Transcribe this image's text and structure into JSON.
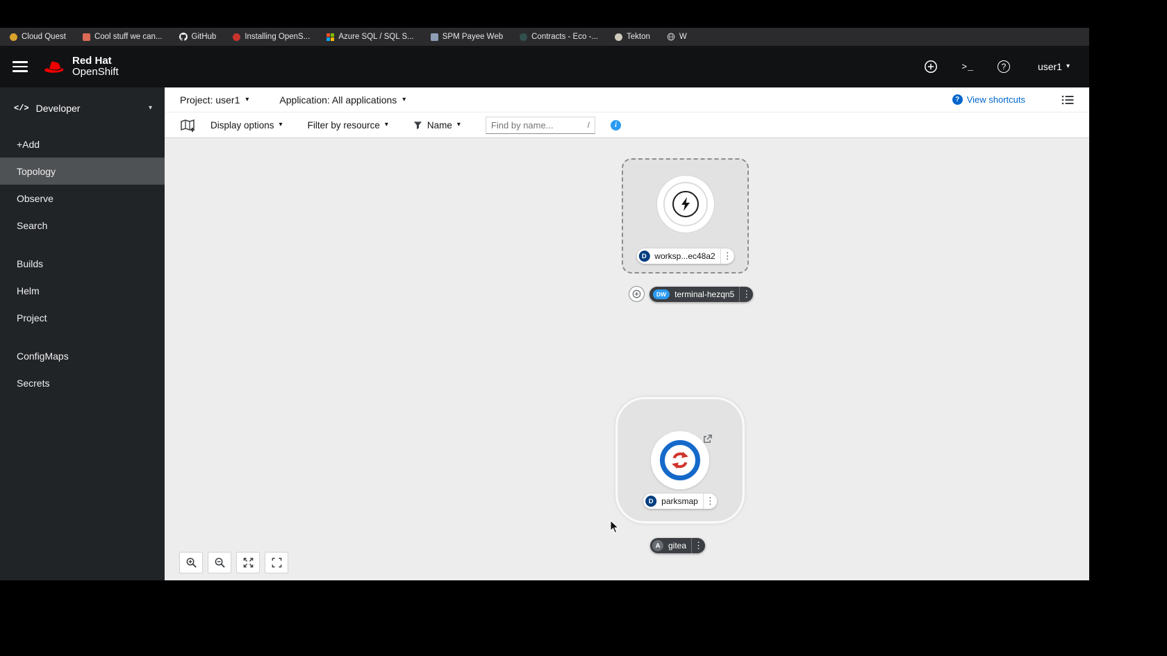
{
  "bookmarks": {
    "items": [
      {
        "label": "Cloud Quest",
        "icon": "cloud-quest-favicon",
        "color": "#d8a22b"
      },
      {
        "label": "Cool stuff we can...",
        "icon": "page-favicon",
        "color": "#d96a55"
      },
      {
        "label": "GitHub",
        "icon": "github-icon",
        "color": "#f5f5f5"
      },
      {
        "label": "Installing OpenS...",
        "icon": "openshift-favicon",
        "color": "#c9342c"
      },
      {
        "label": "Azure SQL / SQL S...",
        "icon": "microsoft-grid-icon",
        "color": "#0078d4"
      },
      {
        "label": "SPM Payee Web",
        "icon": "page-favicon",
        "color": "#8d9db4"
      },
      {
        "label": "Contracts - Eco -...",
        "icon": "dark-favicon",
        "color": "#31514f"
      },
      {
        "label": "Tekton",
        "icon": "tekton-favicon",
        "color": "#cfcabb"
      },
      {
        "label": "W",
        "icon": "globe-icon",
        "color": "#bdbdbd"
      }
    ]
  },
  "masthead": {
    "brand_top": "Red Hat",
    "brand_bottom": "OpenShift",
    "username": "user1"
  },
  "sidebar": {
    "perspective": "Developer",
    "groups": [
      {
        "items": [
          {
            "label": "+Add"
          },
          {
            "label": "Topology"
          },
          {
            "label": "Observe"
          },
          {
            "label": "Search"
          }
        ]
      },
      {
        "items": [
          {
            "label": "Builds"
          },
          {
            "label": "Helm"
          },
          {
            "label": "Project"
          }
        ]
      },
      {
        "items": [
          {
            "label": "ConfigMaps"
          },
          {
            "label": "Secrets"
          }
        ]
      }
    ]
  },
  "context_bar": {
    "project": "Project: user1",
    "application": "Application: All applications",
    "view_shortcuts": "View shortcuts"
  },
  "toolbar": {
    "display_options": "Display options",
    "filter_by_resource": "Filter by resource",
    "name_filter": "Name",
    "find_placeholder": "Find by name...",
    "shortcut_hint": "/"
  },
  "topology": {
    "workspace_node": {
      "badge": "D",
      "label": "worksp...ec48a2"
    },
    "terminal_node": {
      "badge": "DW",
      "label": "terminal-hezqn5"
    },
    "parksmap_node": {
      "badge": "D",
      "label": "parksmap"
    },
    "application_group": {
      "badge": "A",
      "label": "gitea"
    }
  },
  "colors": {
    "accent_blue": "#0066cc",
    "info_blue": "#2b9af3",
    "badge_navy": "#003e7e",
    "badge_gray": "#6a6e73",
    "brand_red": "#ee0000"
  }
}
